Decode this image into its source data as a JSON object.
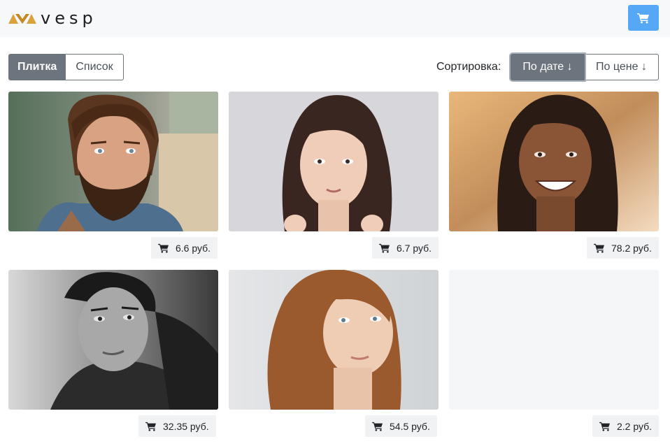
{
  "header": {
    "logo_text": "vesp",
    "logo_icon": "vesp-logo-mark",
    "cart_icon": "cart-icon",
    "accent_color": "#55a8f5"
  },
  "toolbar": {
    "view_tile_label": "Плитка",
    "view_list_label": "Список",
    "active_view": "Плитка",
    "sort_label": "Сортировка:",
    "sort_date_label": "По дате ↓",
    "sort_price_label": "По цене ↓",
    "active_sort": "По дате ↓"
  },
  "products": [
    {
      "price": "6.6 руб.",
      "image": "bearded-man-portrait"
    },
    {
      "price": "6.7 руб.",
      "image": "woman-dark-hair-portrait"
    },
    {
      "price": "78.2 руб.",
      "image": "smiling-woman-braids-portrait"
    },
    {
      "price": "32.35 руб.",
      "image": "man-black-white-portrait"
    },
    {
      "price": "54.5 руб.",
      "image": "woman-auburn-hair-portrait"
    },
    {
      "price": "2.2 руб.",
      "image": "empty-placeholder"
    }
  ]
}
